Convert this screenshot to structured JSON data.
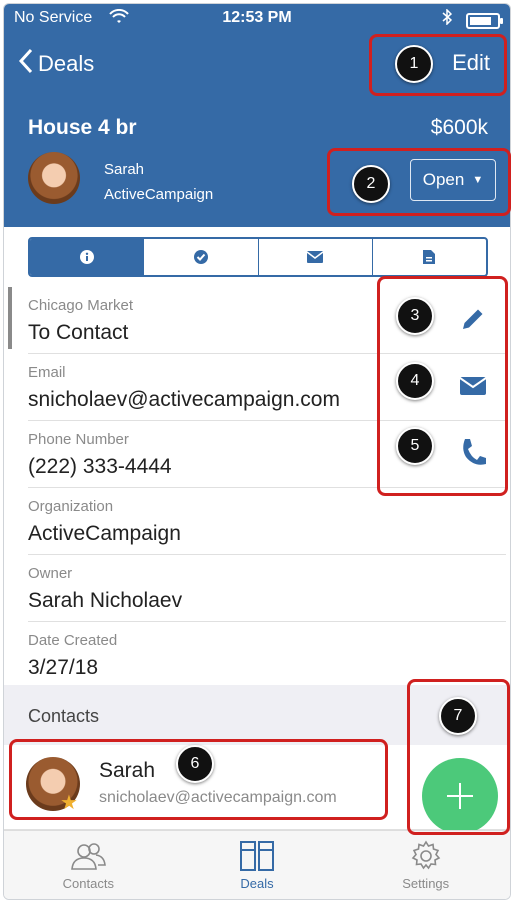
{
  "status_bar": {
    "carrier": "No Service",
    "time": "12:53 PM"
  },
  "nav": {
    "back_label": "Deals",
    "edit_label": "Edit"
  },
  "deal": {
    "title": "House 4 br",
    "value": "$600k",
    "owner_name": "Sarah",
    "owner_company": "ActiveCampaign",
    "status": "Open"
  },
  "tabs": [
    "info-icon",
    "check-icon",
    "mail-icon",
    "file-icon"
  ],
  "fields": [
    {
      "label": "Chicago Market",
      "value": "To Contact"
    },
    {
      "label": "Email",
      "value": "snicholaev@activecampaign.com"
    },
    {
      "label": "Phone Number",
      "value": "(222) 333-4444"
    },
    {
      "label": "Organization",
      "value": "ActiveCampaign"
    },
    {
      "label": "Owner",
      "value": "Sarah Nicholaev"
    },
    {
      "label": "Date Created",
      "value": "3/27/18"
    }
  ],
  "contacts_section": {
    "title": "Contacts"
  },
  "contact": {
    "name": "Sarah",
    "email": "snicholaev@activecampaign.com"
  },
  "tabbar": [
    {
      "label": "Contacts",
      "icon": "contacts-icon"
    },
    {
      "label": "Deals",
      "icon": "deals-icon"
    },
    {
      "label": "Settings",
      "icon": "gear-icon"
    }
  ],
  "callouts": [
    "1",
    "2",
    "3",
    "4",
    "5",
    "6",
    "7"
  ],
  "colors": {
    "primary": "#356aa6",
    "fab": "#4cc97a",
    "callout": "#d0201f"
  }
}
